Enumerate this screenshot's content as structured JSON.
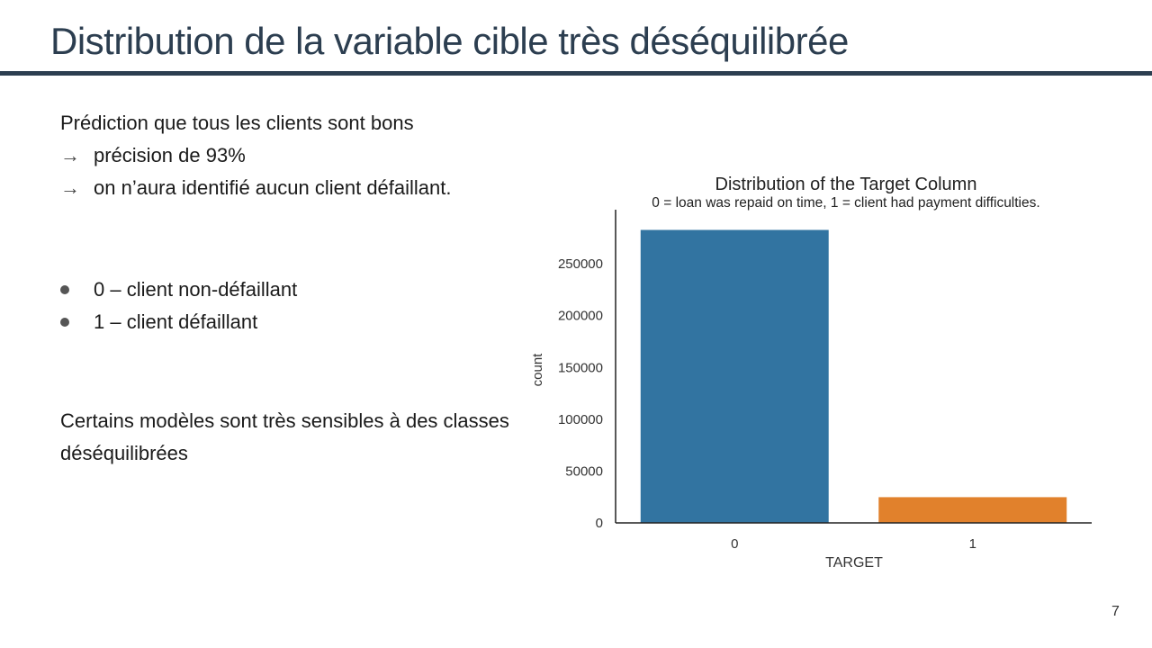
{
  "slide": {
    "title": "Distribution de la variable cible très déséquilibrée",
    "page_number": "7",
    "intro": {
      "heading": "Prédiction que tous les clients sont bons",
      "arrow_items": [
        "précision de 93%",
        "on n’aura identifié aucun client défaillant."
      ]
    },
    "legend_items": [
      "0 – client non-défaillant",
      "1 – client défaillant"
    ],
    "note": "Certains modèles sont très sensibles à des classes déséquilibrées",
    "icons": {
      "arrow": "right-arrow-icon",
      "bullet": "bullet-icon"
    }
  },
  "chart_data": {
    "type": "bar",
    "title": "Distribution of the Target Column",
    "subtitle": "0 = loan was repaid on time,  1 = client had payment difficulties.",
    "xlabel": "TARGET",
    "ylabel": "count",
    "categories": [
      "0",
      "1"
    ],
    "values": [
      282686,
      24825
    ],
    "colors": [
      "#3274a1",
      "#e1812c"
    ],
    "yticks": [
      0,
      50000,
      100000,
      150000,
      200000,
      250000
    ],
    "ylim": [
      0,
      297000
    ],
    "grid": false
  }
}
